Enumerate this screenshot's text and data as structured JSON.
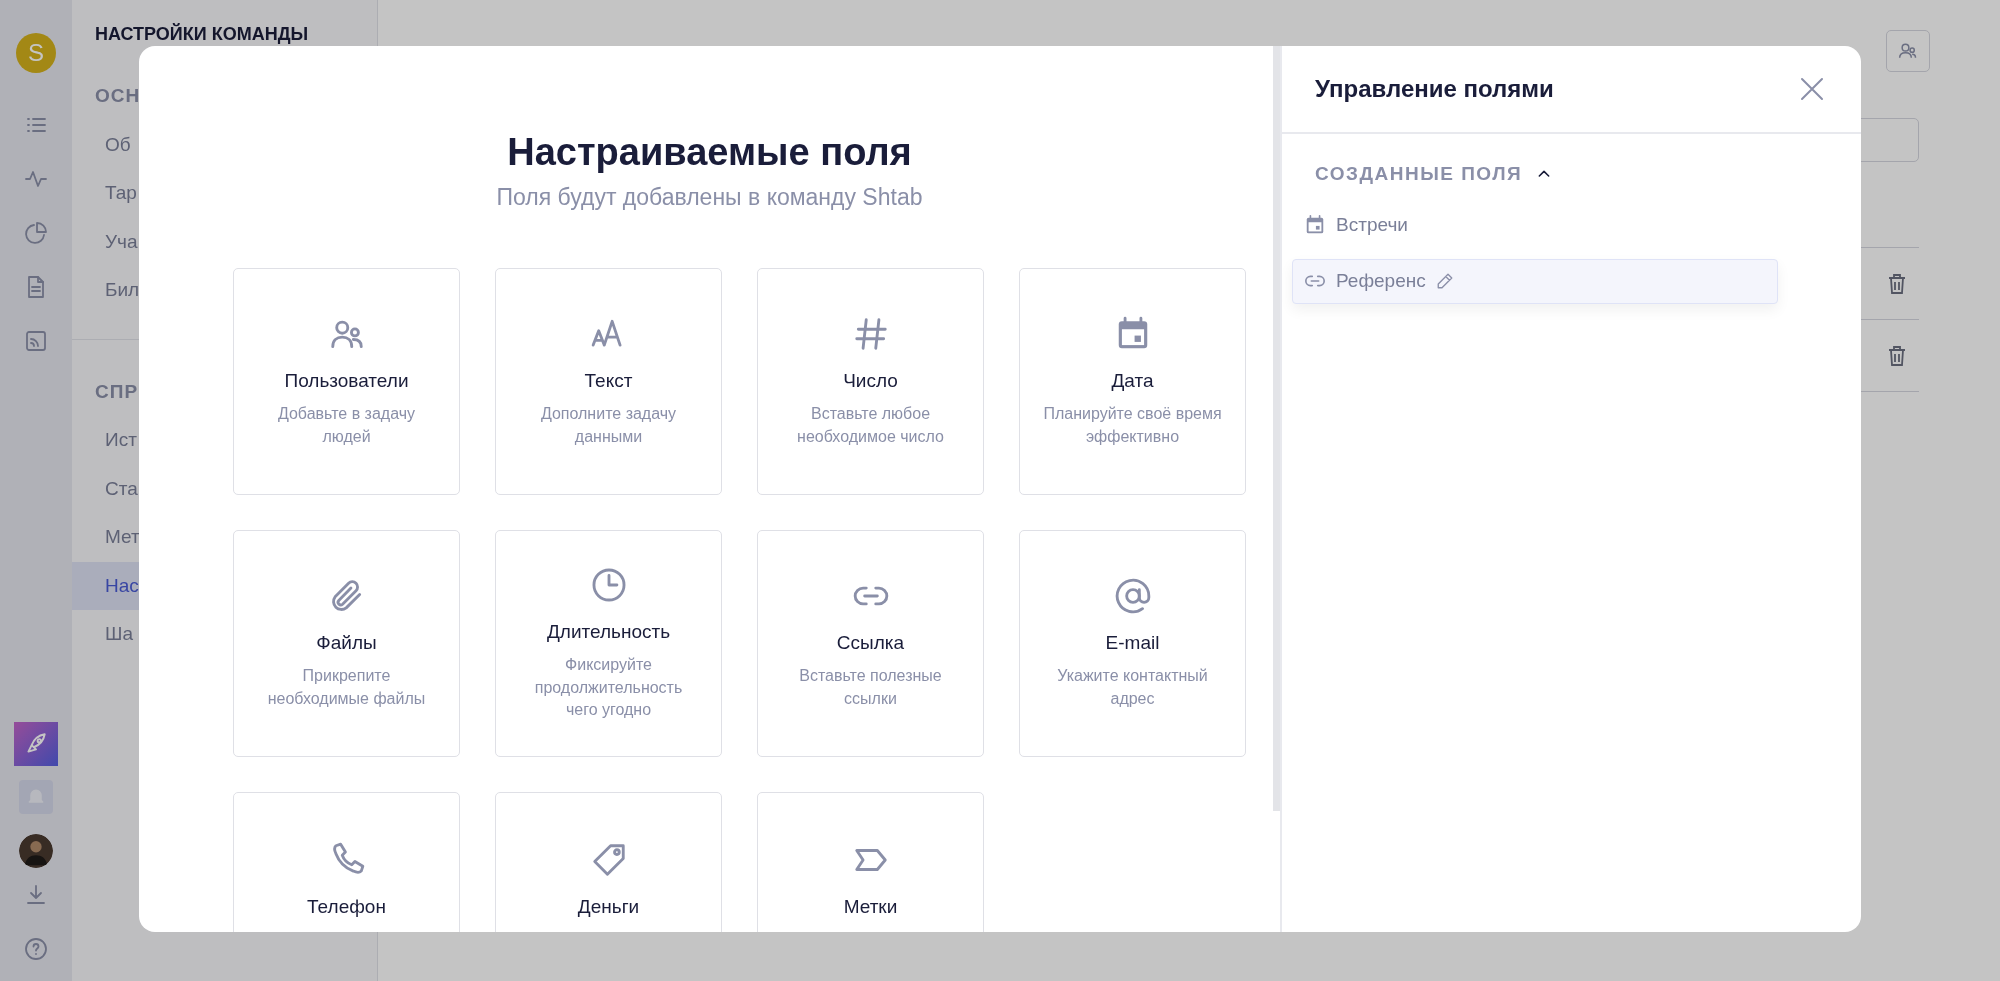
{
  "rail": {
    "avatar_letter": "S"
  },
  "settings_sidebar": {
    "title": "НАСТРОЙКИ КОМАНДЫ",
    "sections": [
      {
        "heading": "ОСН",
        "items": [
          {
            "label": "Об",
            "selected": false
          },
          {
            "label": "Тар",
            "selected": false
          },
          {
            "label": "Уча",
            "selected": false
          },
          {
            "label": "Бил",
            "selected": false
          }
        ]
      },
      {
        "heading": "СПР",
        "items": [
          {
            "label": "Ист",
            "selected": false
          },
          {
            "label": "Ста",
            "selected": false
          },
          {
            "label": "Мет",
            "selected": false
          },
          {
            "label": "Нас",
            "selected": true
          },
          {
            "label": "Ша",
            "selected": false
          }
        ]
      }
    ]
  },
  "modal": {
    "title": "Настраиваемые поля",
    "subtitle": "Поля будут добавлены в команду Shtab",
    "field_types": [
      {
        "kind": "users",
        "title": "Пользователи",
        "description": "Добавьте в задачу людей"
      },
      {
        "kind": "text",
        "title": "Текст",
        "description": "Дополните задачу данными"
      },
      {
        "kind": "number",
        "title": "Число",
        "description": "Вставьте любое необходимое число"
      },
      {
        "kind": "date",
        "title": "Дата",
        "description": "Планируйте своё время эффективно"
      },
      {
        "kind": "files",
        "title": "Файлы",
        "description": "Прикрепите необходимые файлы"
      },
      {
        "kind": "duration",
        "title": "Длительность",
        "description": "Фиксируйте продолжительность чего угодно"
      },
      {
        "kind": "link",
        "title": "Ссылка",
        "description": "Вставьте полезные ссылки"
      },
      {
        "kind": "email",
        "title": "E-mail",
        "description": "Укажите контактный адрес"
      },
      {
        "kind": "phone",
        "title": "Телефон"
      },
      {
        "kind": "money",
        "title": "Деньги"
      },
      {
        "kind": "tags",
        "title": "Метки"
      }
    ]
  },
  "panel": {
    "title": "Управление полями",
    "section": {
      "heading": "СОЗДАННЫЕ ПОЛЯ",
      "expanded": true,
      "fields": [
        {
          "kind": "date",
          "label": "Встречи",
          "selected": false
        },
        {
          "kind": "link",
          "label": "Референс",
          "selected": true
        }
      ]
    }
  }
}
